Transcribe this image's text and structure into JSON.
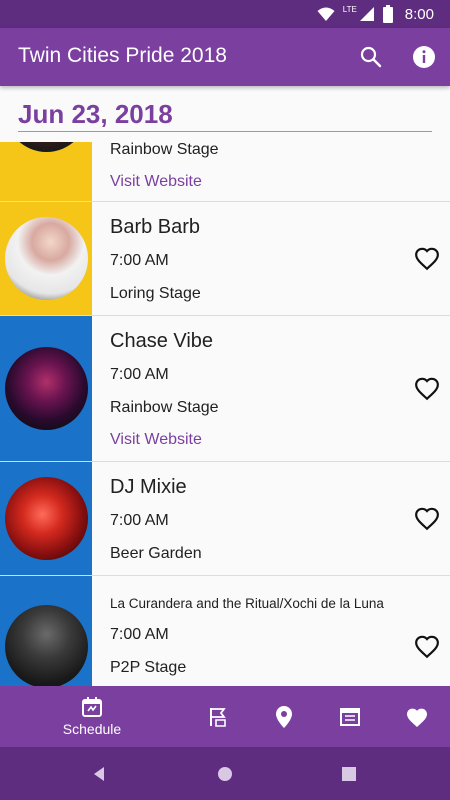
{
  "status_bar": {
    "time": "8:00",
    "network": "LTE"
  },
  "app_bar": {
    "title": "Twin Cities Pride 2018",
    "search_icon": "search-icon",
    "info_icon": "info-icon"
  },
  "schedule": {
    "date": "Jun 23, 2018",
    "items": [
      {
        "name": "",
        "time": "",
        "stage": "Rainbow Stage",
        "link": "Visit Website",
        "thumb_color": "#f5c518",
        "favorite": false
      },
      {
        "name": "Barb Barb",
        "time": "7:00 AM",
        "stage": "Loring Stage",
        "thumb_color": "#f5c518",
        "favorite": false
      },
      {
        "name": "Chase Vibe",
        "time": "7:00 AM",
        "stage": "Rainbow Stage",
        "link": "Visit Website",
        "thumb_color": "#1a73c8",
        "favorite": false
      },
      {
        "name": "DJ Mixie",
        "time": "7:00 AM",
        "stage": "Beer Garden",
        "thumb_color": "#1a73c8",
        "favorite": false
      },
      {
        "name": "La Curandera and the Ritual/Xochi de la Luna",
        "time": "7:00 AM",
        "stage": "P2P Stage",
        "thumb_color": "#1a73c8",
        "favorite": false
      }
    ]
  },
  "bottom_nav": {
    "items": [
      {
        "label": "Schedule",
        "icon": "calendar-icon",
        "active": true
      },
      {
        "label": "",
        "icon": "stage-icon",
        "active": false
      },
      {
        "label": "",
        "icon": "map-pin-icon",
        "active": false
      },
      {
        "label": "",
        "icon": "vendors-icon",
        "active": false
      },
      {
        "label": "",
        "icon": "favorites-icon",
        "active": false
      }
    ]
  },
  "colors": {
    "primary": "#7b3fa0",
    "primary_dark": "#5f2d7f",
    "yellow": "#f5c518",
    "blue": "#1a73c8"
  }
}
